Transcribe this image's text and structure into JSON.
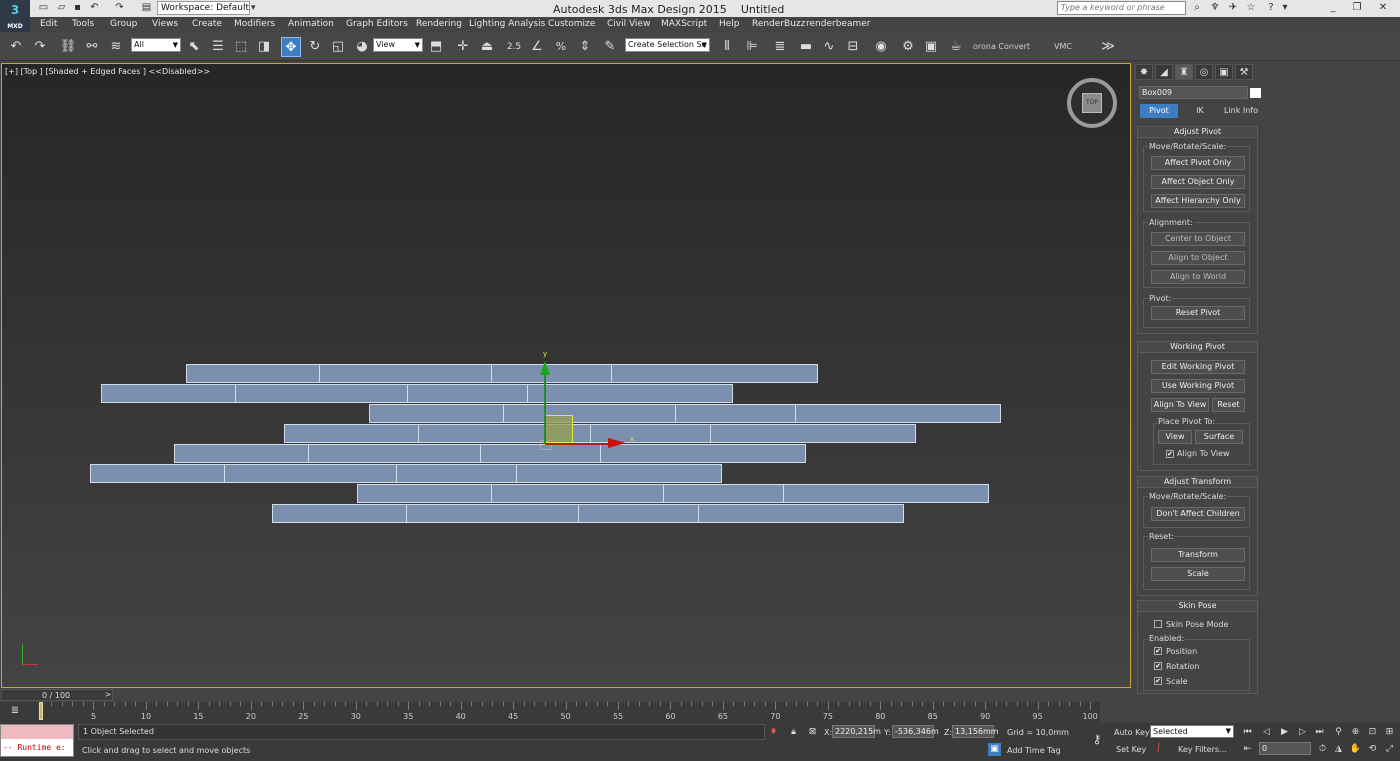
{
  "titlebar": {
    "logo_sub": "MXD",
    "workspace": "Workspace: Default",
    "app_title": "Autodesk 3ds Max Design 2015",
    "doc_title": "Untitled",
    "search_placeholder": "Type a keyword or phrase"
  },
  "menu": [
    "Edit",
    "Tools",
    "Group",
    "Views",
    "Create",
    "Modifiers",
    "Animation",
    "Graph Editors",
    "Rendering",
    "Lighting Analysis",
    "Customize",
    "Civil View",
    "MAXScript",
    "Help",
    "RenderBuzz",
    "renderbeamer"
  ],
  "toolbar": {
    "filter_value": "All",
    "coord_value": "View",
    "selection_set_value": "Create Selection Se",
    "snap_angle": "2.5",
    "corona_label": "orona Convert",
    "vmc_label": "VMC"
  },
  "viewport": {
    "label": "[+] [Top ] [Shaded + Edged Faces ]  <<Disabled>>",
    "viewcube_face": "TOP",
    "axis_x": "x",
    "axis_y": "y"
  },
  "command_panel": {
    "object_name": "Box009",
    "tabs": [
      "Pivot",
      "IK",
      "Link Info"
    ],
    "adjust_pivot": {
      "title": "Adjust Pivot",
      "move_group": "Move/Rotate/Scale:",
      "affect_pivot": "Affect Pivot Only",
      "affect_object": "Affect Object Only",
      "affect_hierarchy": "Affect Hierarchy Only",
      "alignment_group": "Alignment:",
      "center_to_object": "Center to Object",
      "align_to_object": "Align to Object",
      "align_to_world": "Align to World",
      "pivot_group": "Pivot:",
      "reset_pivot": "Reset Pivot"
    },
    "working_pivot": {
      "title": "Working Pivot",
      "edit": "Edit Working Pivot",
      "use": "Use Working Pivot",
      "align_to_view": "Align To View",
      "reset": "Reset",
      "place_group": "Place Pivot To:",
      "view": "View",
      "surface": "Surface",
      "align_to_view_chk": "Align To View"
    },
    "adjust_transform": {
      "title": "Adjust Transform",
      "move_group": "Move/Rotate/Scale:",
      "dont_affect": "Don't Affect Children",
      "reset_group": "Reset:",
      "transform": "Transform",
      "scale": "Scale"
    },
    "skin_pose": {
      "title": "Skin Pose",
      "mode": "Skin Pose Mode",
      "enabled_group": "Enabled:",
      "position": "Position",
      "rotation": "Rotation",
      "scale": "Scale"
    }
  },
  "timeline": {
    "slider": "0 / 100",
    "ticks": [
      "5",
      "10",
      "15",
      "20",
      "25",
      "30",
      "35",
      "40",
      "45",
      "50",
      "55",
      "60",
      "65",
      "70",
      "75",
      "80",
      "85",
      "90",
      "95",
      "100"
    ]
  },
  "status": {
    "runtime": "-- Runtime e:",
    "selected": "1 Object Selected",
    "prompt": "Click and drag to select and move objects",
    "x_label": "X:",
    "x_value": "2220,215m",
    "y_label": "Y:",
    "y_value": "-536,346m",
    "z_label": "Z:",
    "z_value": "13,156mm",
    "grid": "Grid = 10,0mm",
    "add_time_tag": "Add Time Tag",
    "auto_key": "Auto Key",
    "set_key": "Set Key",
    "key_mode": "Selected",
    "key_filters": "Key Filters...",
    "frame": "0"
  }
}
